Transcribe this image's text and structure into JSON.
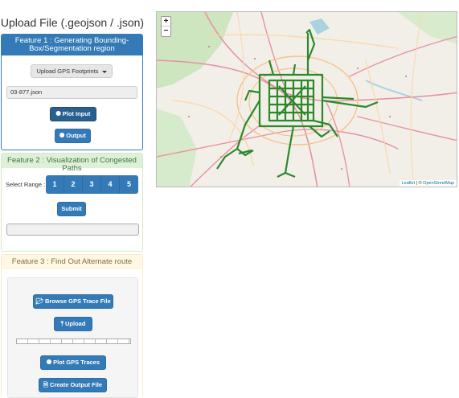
{
  "upload": {
    "title": "Upload File (.geojson / .json)"
  },
  "feature1": {
    "heading": "Feature 1 : Generating Bounding-Box/Segmentation region",
    "dropdown_label": "Upload GPS Footprints",
    "file_value": "03-877.json",
    "plot_input_label": "Plot Input",
    "output_label": "Output"
  },
  "feature2": {
    "heading": "Feature 2 : Visualization of Congested Paths",
    "select_range_label": "Select Range :",
    "ranges": [
      "1",
      "2",
      "3",
      "4",
      "5"
    ],
    "submit_label": "Submit"
  },
  "feature3": {
    "heading": "Feature 3 : Find Out Alternate route",
    "browse_label": "Browse GPS Trace File",
    "upload_label": "Upload",
    "plot_traces_label": "Plot GPS Traces",
    "create_output_label": "Create Output File"
  },
  "map": {
    "zoom_in": "+",
    "zoom_out": "−",
    "attribution_leaflet": "Leaflet",
    "attribution_sep": " | © ",
    "attribution_osm": "OpenStreetMap",
    "trace_color": "#2a8a2a"
  }
}
